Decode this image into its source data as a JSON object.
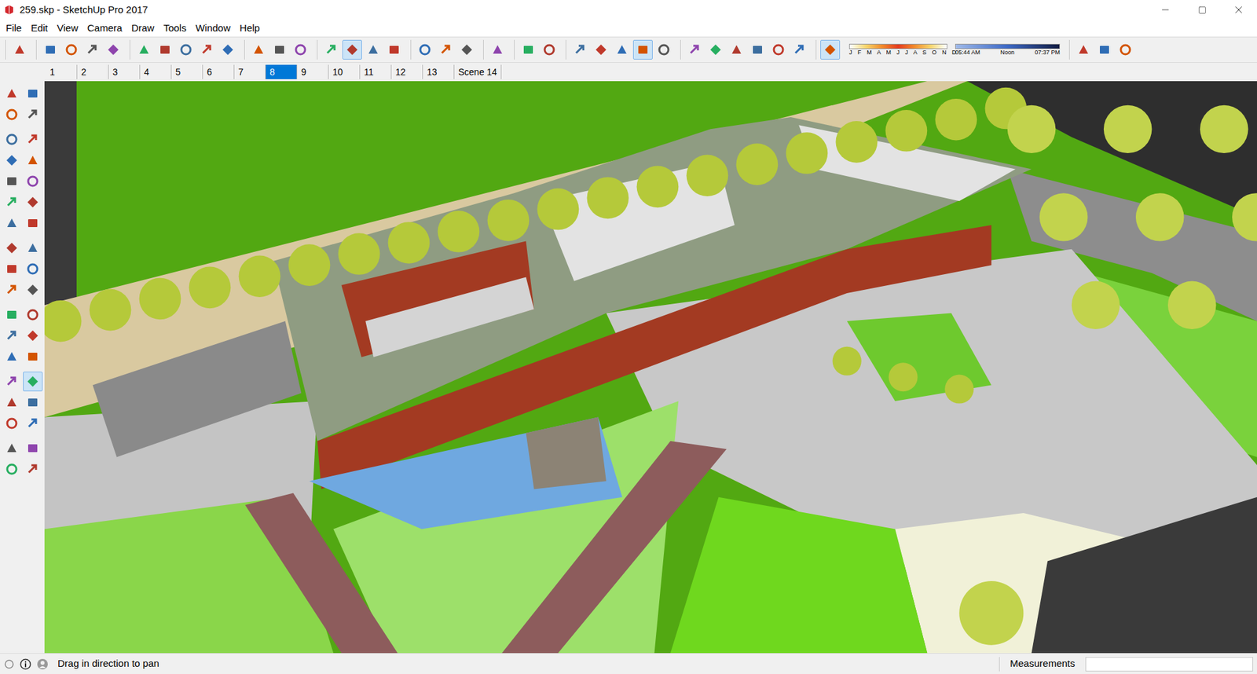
{
  "window": {
    "title": "259.skp - SketchUp Pro 2017"
  },
  "menu": [
    "File",
    "Edit",
    "View",
    "Camera",
    "Draw",
    "Tools",
    "Window",
    "Help"
  ],
  "top_toolbar": [
    [
      {
        "selected": false
      }
    ],
    [
      {
        "selected": false
      },
      {
        "selected": false
      },
      {
        "selected": false
      },
      {
        "selected": false
      }
    ],
    [
      {
        "selected": false
      },
      {
        "selected": false
      },
      {
        "selected": false
      },
      {
        "selected": false
      },
      {
        "selected": false
      }
    ],
    [
      {
        "selected": false
      },
      {
        "selected": false
      },
      {
        "selected": false
      }
    ],
    [
      {
        "selected": false
      },
      {
        "selected": true
      },
      {
        "selected": false
      },
      {
        "selected": false
      }
    ],
    [
      {
        "selected": false
      },
      {
        "selected": false
      },
      {
        "selected": false
      }
    ],
    [
      {
        "selected": false
      }
    ],
    [
      {
        "selected": false
      },
      {
        "selected": false
      }
    ],
    [
      {
        "selected": false
      },
      {
        "selected": false
      },
      {
        "selected": false
      },
      {
        "selected": true
      },
      {
        "selected": false
      }
    ],
    [
      {
        "selected": false
      },
      {
        "selected": false
      },
      {
        "selected": false
      },
      {
        "selected": false
      },
      {
        "selected": false
      },
      {
        "selected": false
      }
    ],
    [
      {
        "selected": true
      }
    ]
  ],
  "shadow": {
    "months": "J F M A M J J A S O N D",
    "start": "05:44 AM",
    "mid": "Noon",
    "end": "07:37 PM"
  },
  "extra_toolbar": [
    {
      "selected": false
    },
    {
      "selected": false
    },
    {
      "selected": false
    }
  ],
  "scenes": [
    {
      "label": "1",
      "selected": false
    },
    {
      "label": "2",
      "selected": false
    },
    {
      "label": "3",
      "selected": false
    },
    {
      "label": "4",
      "selected": false
    },
    {
      "label": "5",
      "selected": false
    },
    {
      "label": "6",
      "selected": false
    },
    {
      "label": "7",
      "selected": false
    },
    {
      "label": "8",
      "selected": true
    },
    {
      "label": "9",
      "selected": false
    },
    {
      "label": "10",
      "selected": false
    },
    {
      "label": "11",
      "selected": false
    },
    {
      "label": "12",
      "selected": false
    },
    {
      "label": "13",
      "selected": false
    },
    {
      "label": "Scene 14",
      "selected": false
    }
  ],
  "left_toolbar": [
    [
      {
        "selected": false
      },
      {
        "selected": false
      },
      {
        "selected": false
      },
      {
        "selected": false
      }
    ],
    [
      {
        "selected": false
      },
      {
        "selected": false
      },
      {
        "selected": false
      },
      {
        "selected": false
      },
      {
        "selected": false
      },
      {
        "selected": false
      },
      {
        "selected": false
      },
      {
        "selected": false
      },
      {
        "selected": false
      },
      {
        "selected": false
      }
    ],
    [
      {
        "selected": false
      },
      {
        "selected": false
      },
      {
        "selected": false
      },
      {
        "selected": false
      },
      {
        "selected": false
      },
      {
        "selected": false
      }
    ],
    [
      {
        "selected": false
      },
      {
        "selected": false
      },
      {
        "selected": false
      },
      {
        "selected": false
      },
      {
        "selected": false
      },
      {
        "selected": false
      }
    ],
    [
      {
        "selected": false
      },
      {
        "selected": true
      },
      {
        "selected": false
      },
      {
        "selected": false
      },
      {
        "selected": false
      },
      {
        "selected": false
      }
    ],
    [
      {
        "selected": false
      },
      {
        "selected": false
      },
      {
        "selected": false
      },
      {
        "selected": false
      }
    ]
  ],
  "status_bar": {
    "hint": "Drag in direction to pan",
    "measurements_label": "Measurements",
    "measurements_value": ""
  }
}
